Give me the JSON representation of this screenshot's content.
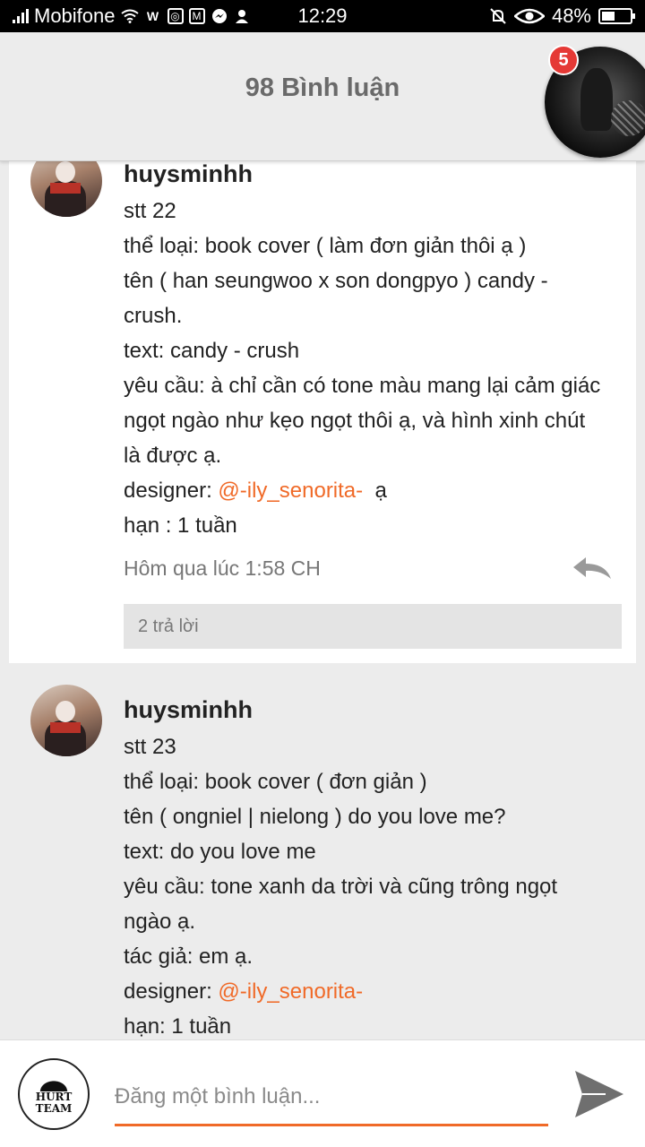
{
  "status_bar": {
    "carrier": "Mobifone",
    "time": "12:29",
    "battery": "48%",
    "battery_level": 0.48,
    "icons": [
      "signal-icon",
      "wifi-icon",
      "w-app-icon",
      "instagram-icon",
      "gmail-icon",
      "messenger-icon",
      "contacts-icon",
      "mute-icon",
      "eye-icon",
      "battery-icon"
    ]
  },
  "header": {
    "title": "98 Bình luận",
    "notification_count": "5"
  },
  "comments": [
    {
      "username": "huysminhh",
      "lines": [
        "stt 22",
        "thể loại: book cover ( làm đơn giản thôi ạ )",
        "tên ( han seungwoo x son dongpyo ) candy -",
        "crush.",
        "text: candy - crush",
        "yêu cầu: à chỉ cần có tone màu mang lại cảm giác",
        "ngọt ngào như kẹo ngọt thôi ạ, và hình xinh chút",
        "là được ạ."
      ],
      "designer_label": "designer: ",
      "designer_mention": "@-ily_senorita-",
      "designer_suffix": "ạ",
      "deadline": "hạn : 1 tuần",
      "time": "Hôm qua lúc 1:58 CH",
      "replies": "2 trả lời"
    },
    {
      "username": "huysminhh",
      "lines": [
        "stt 23",
        "thể loại: book cover ( đơn giản )",
        "tên ( ongniel | nielong ) do you love me?",
        "text: do you love me",
        "yêu cầu: tone xanh da trời và cũng trông ngọt",
        "ngào ạ.",
        "tác giả: em ạ."
      ],
      "designer_label": "designer: ",
      "designer_mention": "@-ily_senorita-",
      "deadline": "hạn: 1 tuần"
    }
  ],
  "footer": {
    "avatar_logo_text": "HURT TEAM",
    "input_placeholder": "Đăng một bình luận...",
    "send_icon": "send-icon"
  },
  "colors": {
    "accent": "#f06a28",
    "badge": "#e53935",
    "header_text": "#6a6a6a"
  }
}
